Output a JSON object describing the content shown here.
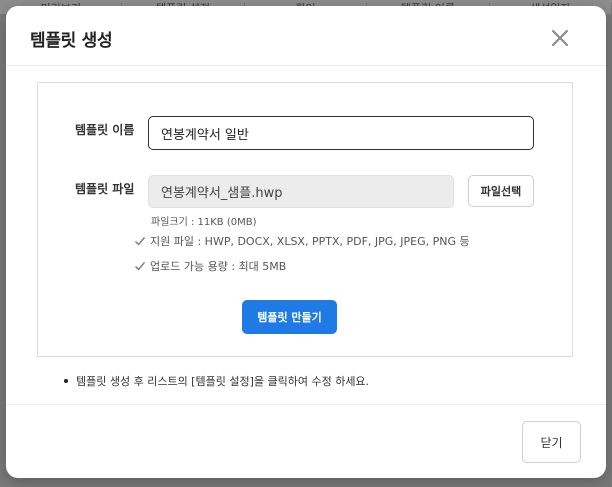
{
  "background": {
    "columns": [
      "미리보기",
      "템플릿 설정",
      "확인",
      "템플릿 이름",
      "생성일자"
    ]
  },
  "modal": {
    "title": "템플릿 생성",
    "close_icon": "close-icon",
    "form": {
      "name_label": "템플릿 이름",
      "name_value": "연봉계약서 일반",
      "file_label": "템플릿 파일",
      "file_value": "연봉계약서_샘플.hwp",
      "file_button": "파일선택",
      "file_size": "파일크기 : 11KB (0MB)",
      "supported_formats": "지원 파일 : HWP, DOCX, XLSX, PPTX, PDF, JPG, JPEG, PNG 등",
      "max_upload": "업로드 가능 용량 : 최대 5MB",
      "create_button": "템플릿 만들기"
    },
    "note": "템플릿 생성 후 리스트의 [템플릿 설정]을 클릭하여 수정 하세요.",
    "footer_close": "닫기"
  },
  "colors": {
    "accent": "#1f7ae6",
    "overlay": "#7a7a7a"
  }
}
